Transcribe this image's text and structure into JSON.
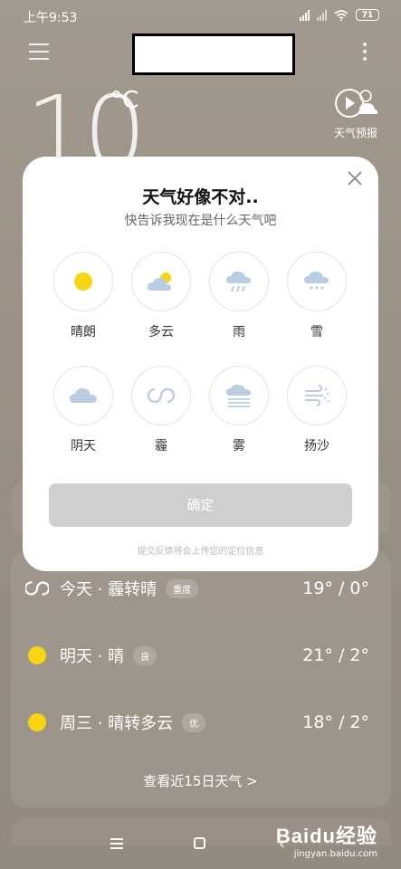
{
  "status_bar": {
    "time": "上午9:53",
    "battery": "71"
  },
  "header": {
    "menu_icon": "menu-icon",
    "more_icon": "more-vertical-icon"
  },
  "current": {
    "temperature": "10",
    "unit": "°C",
    "forecast_label": "天气预报"
  },
  "modal": {
    "title": "天气好像不对..",
    "subtitle": "快告诉我现在是什么天气吧",
    "options": [
      {
        "label": "晴朗",
        "icon": "sun-icon"
      },
      {
        "label": "多云",
        "icon": "partly-cloudy-icon"
      },
      {
        "label": "雨",
        "icon": "rain-icon"
      },
      {
        "label": "雪",
        "icon": "snow-icon"
      },
      {
        "label": "阴天",
        "icon": "overcast-icon"
      },
      {
        "label": "霾",
        "icon": "haze-icon"
      },
      {
        "label": "雾",
        "icon": "fog-icon"
      },
      {
        "label": "扬沙",
        "icon": "sand-icon"
      }
    ],
    "confirm_label": "确定",
    "footer_note": "提交反馈将会上传您的定位信息"
  },
  "daily": [
    {
      "day": "今天 · 霾转晴",
      "badge": "重度",
      "temp": "19° / 0°",
      "icon": "haze-icon"
    },
    {
      "day": "明天 · 晴",
      "badge": "良",
      "temp": "21° / 2°",
      "icon": "sun-icon"
    },
    {
      "day": "周三 · 晴转多云",
      "badge": "优",
      "temp": "18° / 2°",
      "icon": "sun-icon"
    }
  ],
  "view_15_days": "查看近15日天气 >",
  "watermark": {
    "brand": "Baidu经验",
    "url": "jingyan.baidu.com"
  },
  "colors": {
    "sun": "#f7d414",
    "icon_blue": "#b9cde3",
    "confirm_bg": "#cfcfcf"
  }
}
